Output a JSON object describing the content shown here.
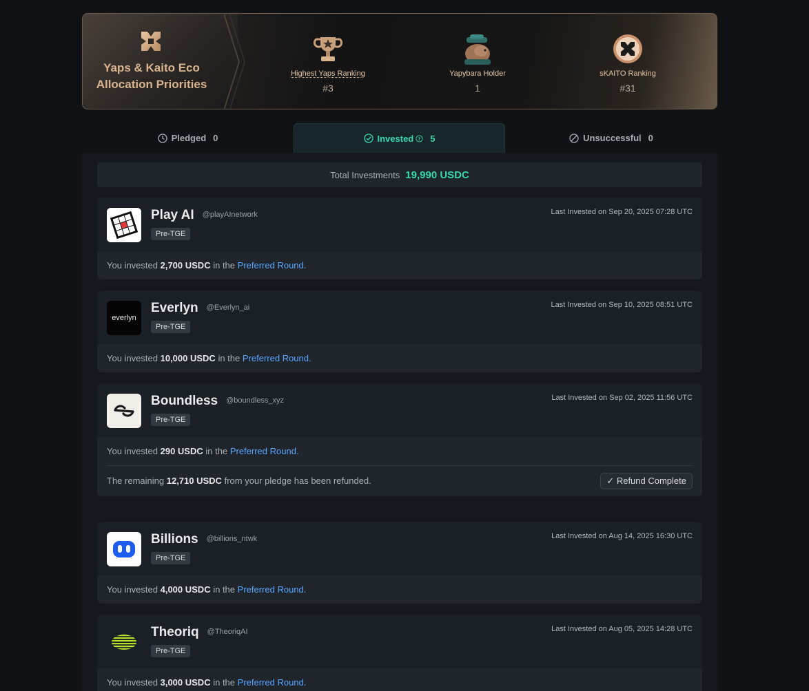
{
  "banner": {
    "title_line1": "Yaps & Kaito Eco",
    "title_line2": "Allocation Priorities",
    "stats": [
      {
        "label": "Highest Yaps Ranking",
        "value": "#3",
        "icon": "trophy-icon"
      },
      {
        "label": "Yapybara Holder",
        "value": "1",
        "icon": "yapybara-icon"
      },
      {
        "label": "sKAITO Ranking",
        "value": "#31",
        "icon": "kaito-coin-icon"
      }
    ]
  },
  "tabs": [
    {
      "label": "Pledged",
      "count": "0",
      "icon": "clock-icon"
    },
    {
      "label": "Invested",
      "count": "5",
      "icon": "check-circle-icon"
    },
    {
      "label": "Unsuccessful",
      "count": "0",
      "icon": "ban-icon"
    }
  ],
  "total": {
    "label": "Total Investments",
    "value": "19,990 USDC"
  },
  "common": {
    "you_invested": "You invested",
    "in_the": "in the",
    "round": "Preferred Round",
    "period": "."
  },
  "investments": [
    {
      "name": "Play AI",
      "handle": "@playAInetwork",
      "badge": "Pre-TGE",
      "last_invested": "Last Invested on Sep 20, 2025 07:28 UTC",
      "amount": "2,700 USDC"
    },
    {
      "name": "Everlyn",
      "handle": "@Everlyn_ai",
      "badge": "Pre-TGE",
      "last_invested": "Last Invested on Sep 10, 2025 08:51 UTC",
      "amount": "10,000 USDC",
      "logo_text": "everlyn"
    },
    {
      "name": "Boundless",
      "handle": "@boundless_xyz",
      "badge": "Pre-TGE",
      "last_invested": "Last Invested on Sep 02, 2025 11:56 UTC",
      "amount": "290 USDC",
      "refund": {
        "prefix": "The remaining",
        "amount": "12,710 USDC",
        "suffix": "from your pledge has been refunded.",
        "button": "Refund Complete"
      }
    },
    {
      "name": "Billions",
      "handle": "@billions_ntwk",
      "badge": "Pre-TGE",
      "last_invested": "Last Invested on Aug 14, 2025 16:30 UTC",
      "amount": "4,000 USDC"
    },
    {
      "name": "Theoriq",
      "handle": "@TheoriqAI",
      "badge": "Pre-TGE",
      "last_invested": "Last Invested on Aug 05, 2025 14:28 UTC",
      "amount": "3,000 USDC"
    }
  ],
  "colors": {
    "accent": "#38d9b0",
    "link": "#58a6ff",
    "gold": "#d9b48f"
  }
}
